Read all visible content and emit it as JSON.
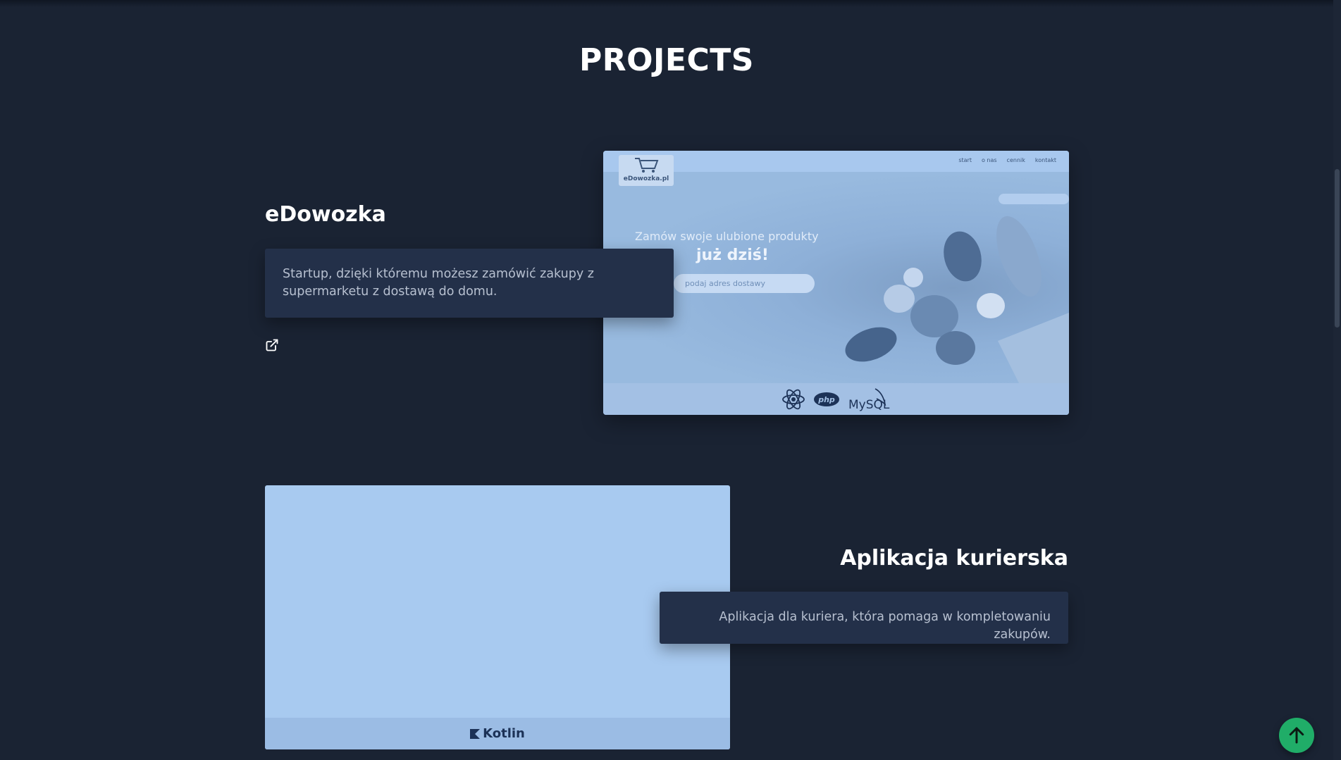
{
  "section": {
    "title": "PROJECTS"
  },
  "projects": [
    {
      "title": "eDowozka",
      "description": "Startup, dzięki któremu możesz zamówić zakupy z supermarketu z dostawą do domu.",
      "link_icon": "external-link-icon",
      "screenshot": {
        "logo_text": "eDowozka.pl",
        "menu": [
          "start",
          "o nas",
          "cennik",
          "kontakt"
        ],
        "lead": "Zamów swoje ulubione produkty",
        "headline": "już dziś!",
        "input_placeholder": "podaj adres dostawy"
      },
      "tech": [
        "react-icon",
        "php",
        "MySQL"
      ]
    },
    {
      "title": "Aplikacja kurierska",
      "description": "Aplikacja dla kuriera, która pomaga w kompletowaniu zakupów.",
      "tech": [
        "Kotlin"
      ]
    }
  ],
  "back_to_top": {
    "icon": "arrow-up-icon",
    "color": "#20ad68"
  },
  "colors": {
    "background": "#1a2333",
    "card": "#233049",
    "image_tint": "#a8caf0"
  }
}
